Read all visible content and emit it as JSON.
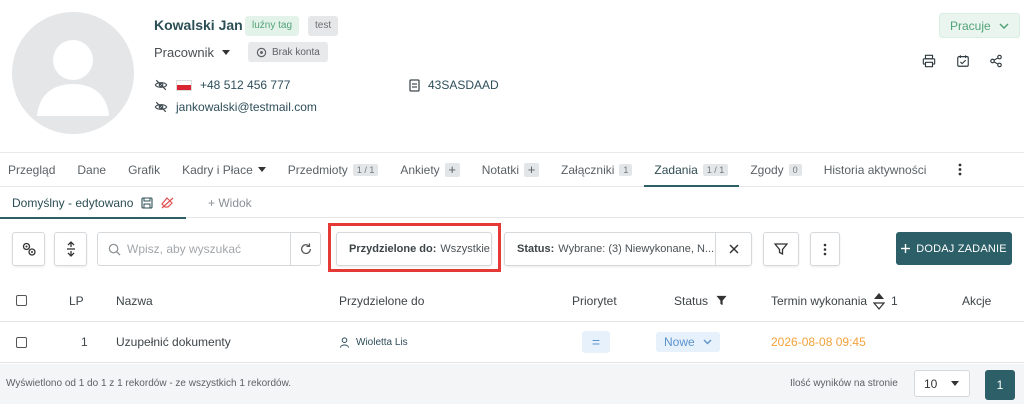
{
  "profile": {
    "name": "Kowalski Jan",
    "tags": [
      "luźny tag",
      "test"
    ],
    "role": "Pracownik",
    "account_status": "Brak konta",
    "phone": "+48 512 456 777",
    "email": "jankowalski@testmail.com",
    "id_code": "43SASDAAD",
    "employment_status": "Pracuje"
  },
  "tabs": [
    {
      "label": "Przegląd"
    },
    {
      "label": "Dane"
    },
    {
      "label": "Grafik"
    },
    {
      "label": "Kadry i Płace"
    },
    {
      "label": "Przedmioty",
      "badge": "1 / 1"
    },
    {
      "label": "Ankiety"
    },
    {
      "label": "Notatki"
    },
    {
      "label": "Załączniki",
      "badge": "1"
    },
    {
      "label": "Zadania",
      "badge": "1 / 1"
    },
    {
      "label": "Zgody",
      "badge": "0"
    },
    {
      "label": "Historia aktywności"
    }
  ],
  "views": {
    "active": "Domyślny - edytowano",
    "add": "+ Widok"
  },
  "toolbar": {
    "search_placeholder": "Wpisz, aby wyszukać",
    "assigned_label": "Przydzielone do:",
    "assigned_value": "Wszystkie",
    "status_label": "Status:",
    "status_value": "Wybrane: (3) Niewykonane, N...",
    "add_task": "DODAJ ZADANIE"
  },
  "table": {
    "headers": {
      "lp": "LP",
      "name": "Nazwa",
      "assigned": "Przydzielone do",
      "priority": "Priorytet",
      "status": "Status",
      "deadline": "Termin wykonania",
      "sort_index": "1",
      "actions": "Akcje"
    },
    "rows": [
      {
        "lp": "1",
        "name": "Uzupełnić dokumenty",
        "assigned": "Wioletta Lis",
        "priority": "=",
        "status": "Nowe",
        "deadline": "2026-08-08 09:45"
      }
    ]
  },
  "footer": {
    "summary": "Wyświetlono od 1 do 1 z 1 rekordów - ze wszystkich 1 rekordów.",
    "per_page_label": "Ilość wyników na stronie",
    "per_page_value": "10",
    "current_page": "1"
  },
  "colors": {
    "accent": "#2c5f67",
    "highlight": "#e53935",
    "deadline": "#f3a23a",
    "status_green": "#52a379"
  }
}
